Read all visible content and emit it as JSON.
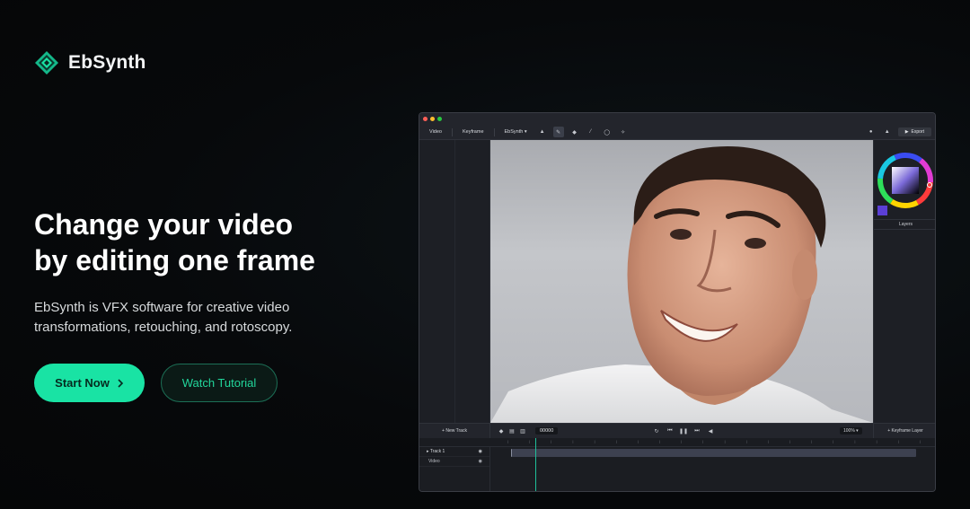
{
  "brand": {
    "name": "EbSynth",
    "accent": "#19e3a4"
  },
  "hero": {
    "headline_line1": "Change your video",
    "headline_line2": "by editing one frame",
    "subtext_line1": "EbSynth is VFX software for creative video",
    "subtext_line2": "transformations, retouching, and rotoscopy.",
    "primary_cta": "Start Now",
    "secondary_cta": "Watch Tutorial"
  },
  "app": {
    "toolbar": {
      "video_tab": "Video",
      "keyframe_tab": "Keyframe",
      "model_select": "EbSynth",
      "export_label": "Export"
    },
    "tools": [
      "select-icon",
      "brush-icon",
      "eraser-icon",
      "eyedropper-icon",
      "lasso-icon",
      "magic-wand-icon"
    ],
    "color_swatch": "#5b3fd6",
    "layers_label": "Layers",
    "bottom_bar": {
      "new_track": "+ New Track",
      "frame_number": "00000",
      "zoom": "100%",
      "keyframe_layer": "+ Keyframe Layer"
    },
    "tracks": [
      {
        "label": "Track 1"
      },
      {
        "label": "Video"
      }
    ]
  }
}
